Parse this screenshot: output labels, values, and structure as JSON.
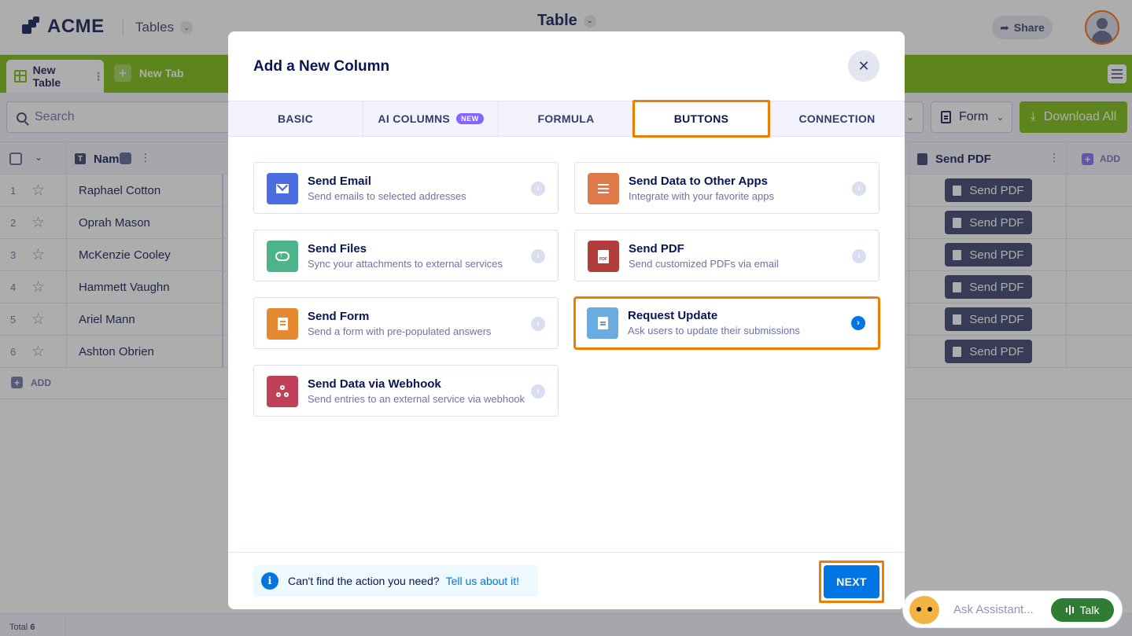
{
  "app": {
    "logo_text": "ACME",
    "tables_label": "Tables",
    "page_title": "Table",
    "share_label": "Share"
  },
  "tabs_bar": {
    "active_tab": "New Table",
    "new_tab": "New Tab"
  },
  "toolbar": {
    "search_placeholder": "Search",
    "form_dropdown": "Form",
    "download_label": "Download All"
  },
  "table": {
    "name_header": "Name",
    "pdf_header": "Send PDF",
    "add_column_label": "ADD",
    "add_row_label": "ADD",
    "rows": [
      {
        "num": "1",
        "name": "Raphael Cotton",
        "button": "Send PDF"
      },
      {
        "num": "2",
        "name": "Oprah Mason",
        "button": "Send PDF"
      },
      {
        "num": "3",
        "name": "McKenzie Cooley",
        "button": "Send PDF"
      },
      {
        "num": "4",
        "name": "Hammett Vaughn",
        "button": "Send PDF"
      },
      {
        "num": "5",
        "name": "Ariel Mann",
        "button": "Send PDF"
      },
      {
        "num": "6",
        "name": "Ashton Obrien",
        "button": "Send PDF"
      }
    ],
    "total_label": "Total",
    "total_value": "6"
  },
  "assistant": {
    "placeholder": "Ask Assistant...",
    "talk_label": "Talk"
  },
  "modal": {
    "title": "Add a New Column",
    "tabs": [
      {
        "label": "BASIC"
      },
      {
        "label": "AI COLUMNS",
        "badge": "NEW"
      },
      {
        "label": "FORMULA"
      },
      {
        "label": "BUTTONS",
        "active": true
      },
      {
        "label": "CONNECTION"
      }
    ],
    "cards": [
      {
        "title": "Send Email",
        "subtitle": "Send emails to selected addresses",
        "icon": "mail-icon",
        "color": "#4a6ee0"
      },
      {
        "title": "Send Data to Other Apps",
        "subtitle": "Integrate with your favorite apps",
        "icon": "apps-icon",
        "color": "#e07a4a"
      },
      {
        "title": "Send Files",
        "subtitle": "Sync your attachments to external services",
        "icon": "cloud-upload-icon",
        "color": "#4db38a"
      },
      {
        "title": "Send PDF",
        "subtitle": "Send customized PDFs via email",
        "icon": "pdf-icon",
        "color": "#b13d3d"
      },
      {
        "title": "Send Form",
        "subtitle": "Send a form with pre-populated answers",
        "icon": "form-icon",
        "color": "#e38a32"
      },
      {
        "title": "Request Update",
        "subtitle": "Ask users to update their submissions",
        "icon": "document-icon",
        "color": "#6aacdf",
        "selected": true
      },
      {
        "title": "Send Data via Webhook",
        "subtitle": "Send entries to an external service via webhook",
        "icon": "webhook-icon",
        "color": "#c0405a"
      }
    ],
    "footer": {
      "info_text": "Can't find the action you need?",
      "link_text": "Tell us about it!",
      "next_label": "NEXT"
    }
  }
}
